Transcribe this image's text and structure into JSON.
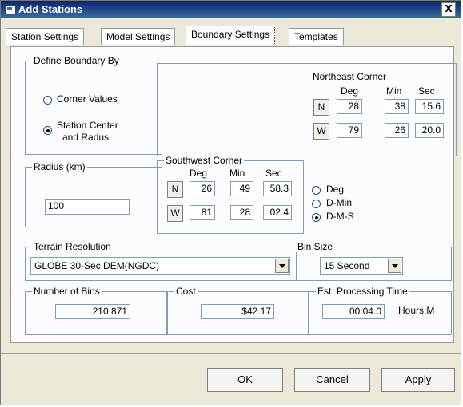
{
  "window": {
    "title": "Add Stations",
    "close_label": "X"
  },
  "tabs": [
    {
      "label": "Station Settings"
    },
    {
      "label": "Model Settings"
    },
    {
      "label": "Boundary Settings",
      "active": true
    },
    {
      "label": "Templates"
    }
  ],
  "define_boundary": {
    "label": "Define Boundary By",
    "options": [
      {
        "label": "Corner Values",
        "selected": false
      },
      {
        "label_line1": "Station Center",
        "label_line2": "and Radus",
        "selected": true
      }
    ]
  },
  "radius": {
    "label": "Radius (km)",
    "value": "100"
  },
  "northeast": {
    "label": "Northeast Corner",
    "headers": {
      "deg": "Deg",
      "min": "Min",
      "sec": "Sec"
    },
    "lat": {
      "dir": "N",
      "deg": "28",
      "min": "38",
      "sec": "15.6"
    },
    "lon": {
      "dir": "W",
      "deg": "79",
      "min": "26",
      "sec": "20.0"
    }
  },
  "southwest": {
    "label": "Southwest Corner",
    "headers": {
      "deg": "Deg",
      "min": "Min",
      "sec": "Sec"
    },
    "lat": {
      "dir": "N",
      "deg": "26",
      "min": "49",
      "sec": "58.3"
    },
    "lon": {
      "dir": "W",
      "deg": "81",
      "min": "28",
      "sec": "02.4"
    }
  },
  "format": {
    "options": [
      {
        "label": "Deg",
        "selected": false
      },
      {
        "label": "D-Min",
        "selected": false
      },
      {
        "label": "D-M-S",
        "selected": true
      }
    ]
  },
  "terrain": {
    "label": "Terrain Resolution",
    "value": "GLOBE 30-Sec DEM(NGDC)"
  },
  "bin_size": {
    "label": "Bin Size",
    "value": "15 Second"
  },
  "num_bins": {
    "label": "Number of Bins",
    "value": "210,871"
  },
  "cost": {
    "label": "Cost",
    "value": "$42.17"
  },
  "processing": {
    "label": "Est. Processing Time",
    "value": "00:04.0",
    "unit": "Hours:M"
  },
  "buttons": {
    "ok": "OK",
    "cancel": "Cancel",
    "apply": "Apply"
  }
}
